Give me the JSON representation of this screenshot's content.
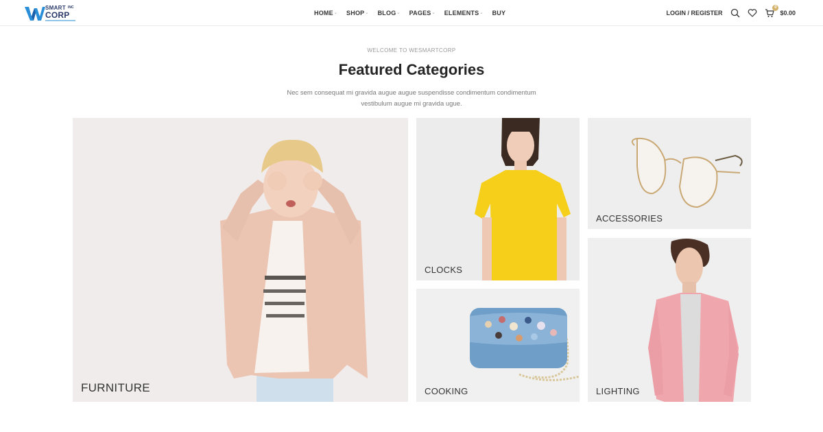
{
  "brand": {
    "smart": "SMART",
    "corp": "CORP",
    "tm": "INC"
  },
  "nav": {
    "items": [
      {
        "label": "HOME",
        "has_caret": true
      },
      {
        "label": "SHOP",
        "has_caret": true
      },
      {
        "label": "BLOG",
        "has_caret": true
      },
      {
        "label": "PAGES",
        "has_caret": true
      },
      {
        "label": "ELEMENTS",
        "has_caret": true
      },
      {
        "label": "BUY",
        "has_caret": false
      }
    ],
    "caret": "⌄"
  },
  "header_right": {
    "login_label": "LOGIN / REGISTER",
    "icons": [
      "search-icon",
      "heart-icon",
      "cart-icon"
    ],
    "cart_count": "0",
    "cart_total": "$0.00"
  },
  "section": {
    "eyebrow": "WELCOME TO WESMARTCORP",
    "title": "Featured Categories",
    "description": "Nec sem consequat mi gravida augue augue suspendisse condimentum condimentum vestibulum augue mi gravida ugue."
  },
  "categories": [
    {
      "label": "FURNITURE"
    },
    {
      "label": "CLOCKS"
    },
    {
      "label": "COOKING"
    },
    {
      "label": "ACCESSORIES"
    },
    {
      "label": "LIGHTING"
    }
  ],
  "colors": {
    "accent": "#d4b36c",
    "logo_blue": "#2a8fd8",
    "logo_navy": "#2a3a6a",
    "text": "#242424"
  }
}
